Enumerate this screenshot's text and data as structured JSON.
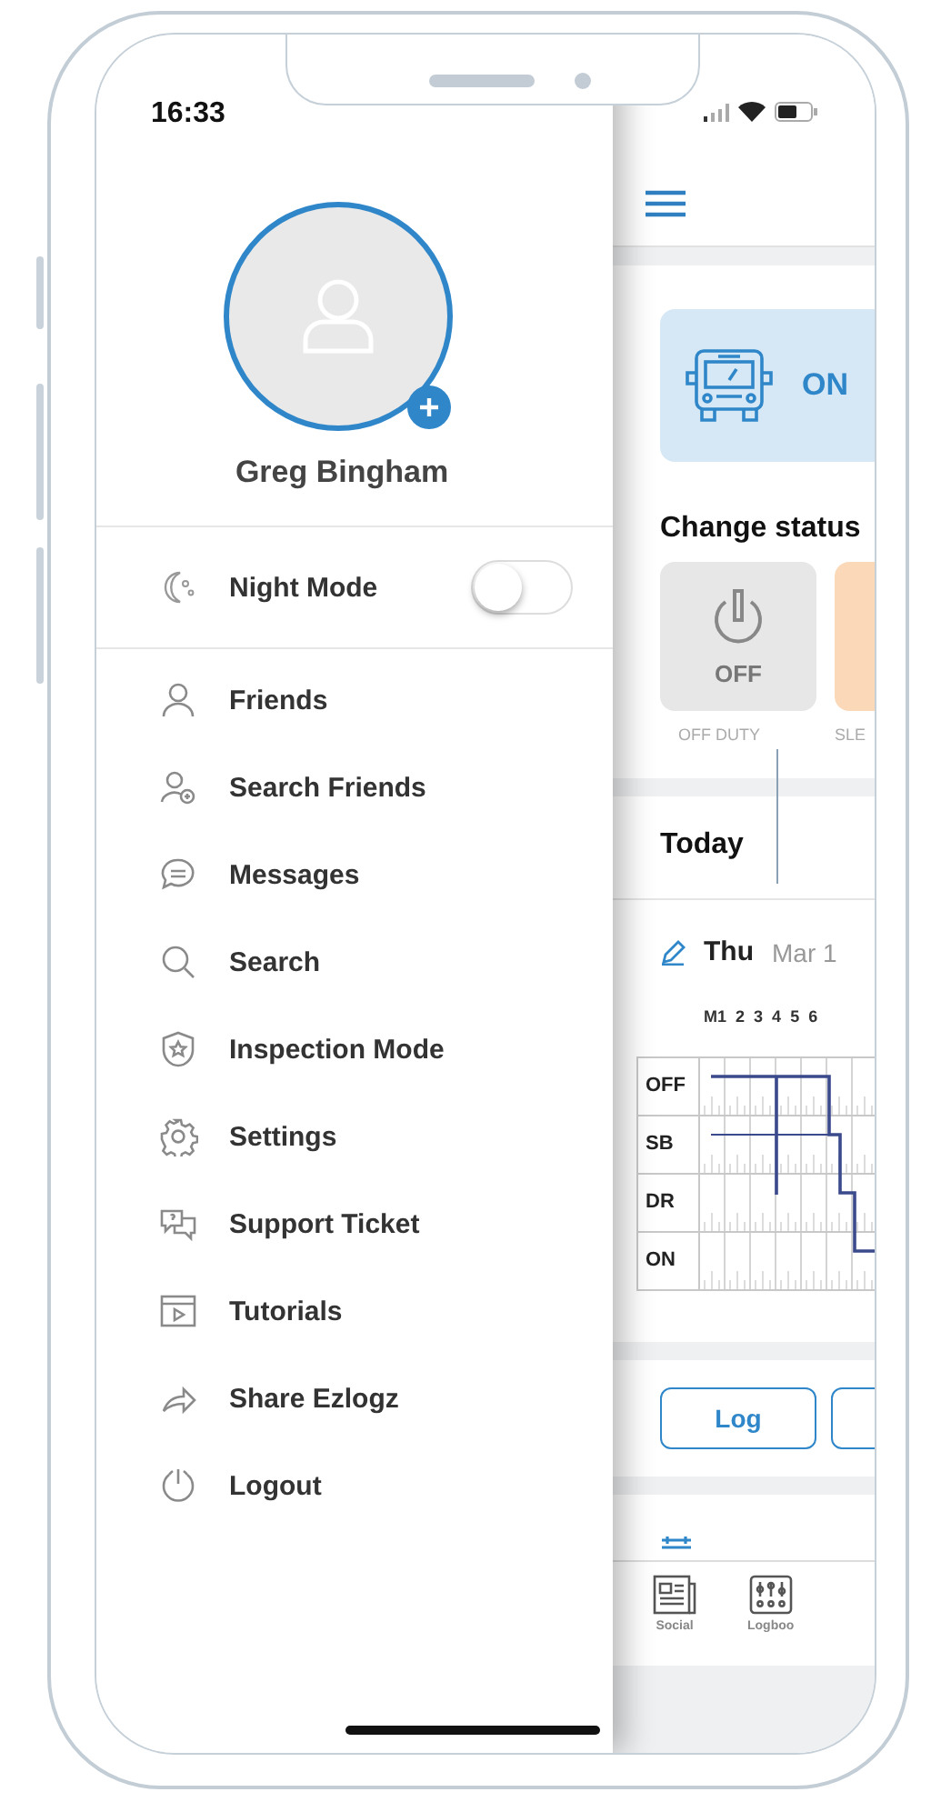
{
  "status_bar": {
    "time": "16:33"
  },
  "profile": {
    "name": "Greg Bingham"
  },
  "night_mode": {
    "label": "Night Mode",
    "on": false
  },
  "menu": [
    {
      "label": "Friends"
    },
    {
      "label": "Search Friends"
    },
    {
      "label": "Messages"
    },
    {
      "label": "Search"
    },
    {
      "label": "Inspection Mode"
    },
    {
      "label": "Settings"
    },
    {
      "label": "Support Ticket"
    },
    {
      "label": "Tutorials"
    },
    {
      "label": "Share Ezlogz"
    },
    {
      "label": "Logout"
    }
  ],
  "main": {
    "status_card": {
      "label": "ON"
    },
    "change_status": {
      "title": "Change status",
      "options": [
        {
          "kind": "off",
          "code": "OFF",
          "caption": "OFF DUTY"
        },
        {
          "kind": "sleep",
          "caption": "SLE"
        }
      ]
    },
    "today": {
      "title": "Today",
      "day": "Thu",
      "date": "Mar 1"
    },
    "log_graph": {
      "hours": [
        "M1",
        "2",
        "3",
        "4",
        "5",
        "6"
      ],
      "rows": [
        "OFF",
        "SB",
        "DR",
        "ON"
      ]
    },
    "action_buttons": [
      "Log"
    ],
    "tab_bar": [
      {
        "label": "Social"
      },
      {
        "label": "Logboo"
      }
    ]
  }
}
